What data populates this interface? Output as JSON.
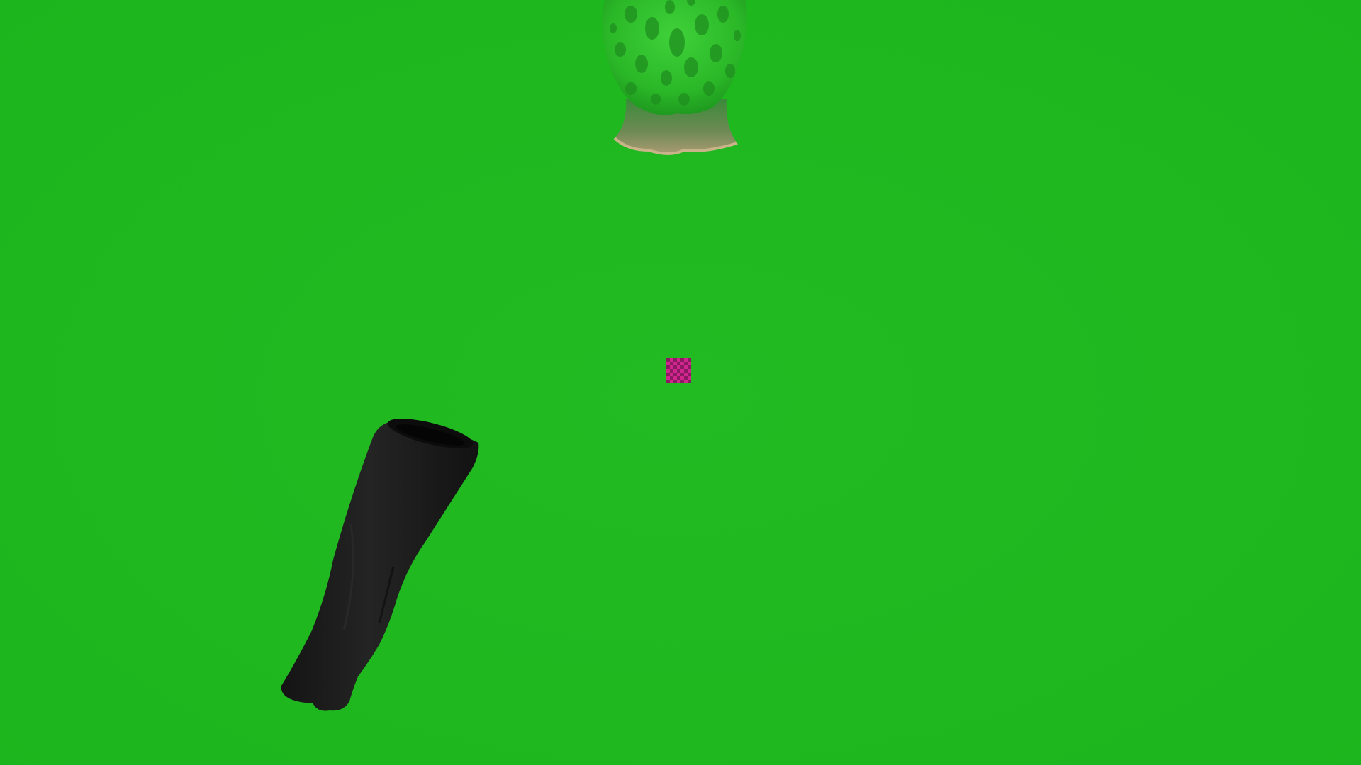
{
  "scene": {
    "background_color": "#1fb71f",
    "objects": [
      {
        "name": "green-spotted-head",
        "colors": {
          "base": "#2fbf2a",
          "spot": "#1f8f1f",
          "neck": "#6f8a55",
          "rim": "#b8a27a"
        }
      },
      {
        "name": "missing-texture-checker",
        "colors": {
          "a": "#d2268f",
          "b": "#8c1a63"
        }
      },
      {
        "name": "black-sleeve",
        "colors": {
          "base": "#1e1e1e",
          "shade": "#111111"
        }
      }
    ]
  }
}
